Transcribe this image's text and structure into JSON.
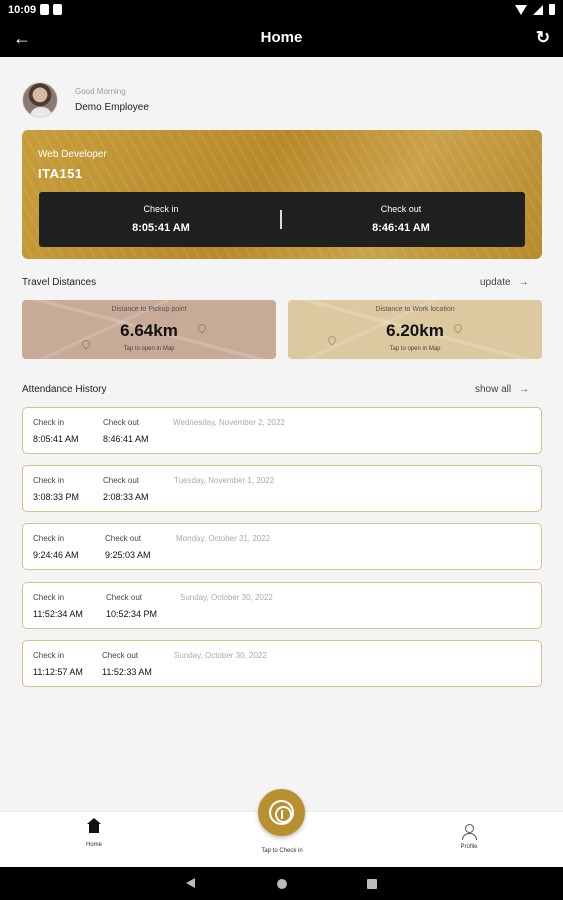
{
  "status_bar": {
    "time": "10:09"
  },
  "app_bar": {
    "title": "Home"
  },
  "greeting": {
    "salutation": "Good Morning",
    "name": "Demo Employee"
  },
  "job_card": {
    "role": "Web Developer",
    "code": "ITA151",
    "check_in_label": "Check in",
    "check_in_time": "8:05:41 AM",
    "check_out_label": "Check out",
    "check_out_time": "8:46:41 AM"
  },
  "travel": {
    "title": "Travel Distances",
    "action": "update",
    "cards": [
      {
        "label": "Distance to Pickup point",
        "value": "6.64km",
        "hint": "Tap to open in Map"
      },
      {
        "label": "Distance to Work location",
        "value": "6.20km",
        "hint": "Tap to open in Map"
      }
    ]
  },
  "history": {
    "title": "Attendance History",
    "action": "show all",
    "entries": [
      {
        "check_in_label": "Check in",
        "check_in": "8:05:41 AM",
        "check_out_label": "Check out",
        "check_out": "8:46:41 AM",
        "date": "Wednesday, November 2, 2022"
      },
      {
        "check_in_label": "Check in",
        "check_in": "3:08:33 PM",
        "check_out_label": "Check out",
        "check_out": "2:08:33 AM",
        "date": "Tuesday, November 1, 2022"
      },
      {
        "check_in_label": "Check in",
        "check_in": "9:24:46 AM",
        "check_out_label": "Check out",
        "check_out": "9:25:03 AM",
        "date": "Monday, October 31, 2022"
      },
      {
        "check_in_label": "Check in",
        "check_in": "11:52:34 AM",
        "check_out_label": "Check out",
        "check_out": "10:52:34 PM",
        "date": "Sunday, October 30, 2022"
      },
      {
        "check_in_label": "Check in",
        "check_in": "11:12:57 AM",
        "check_out_label": "Check out",
        "check_out": "11:52:33 AM",
        "date": "Sunday, October 30, 2022"
      }
    ]
  },
  "bottom_nav": {
    "home": "Home",
    "fab": "Tap to Check in",
    "profile": "Profile"
  },
  "colors": {
    "accent": "#b8902f",
    "dark": "#202020",
    "pickup_card": "#c7ab96",
    "work_card": "#dcc9a0"
  }
}
